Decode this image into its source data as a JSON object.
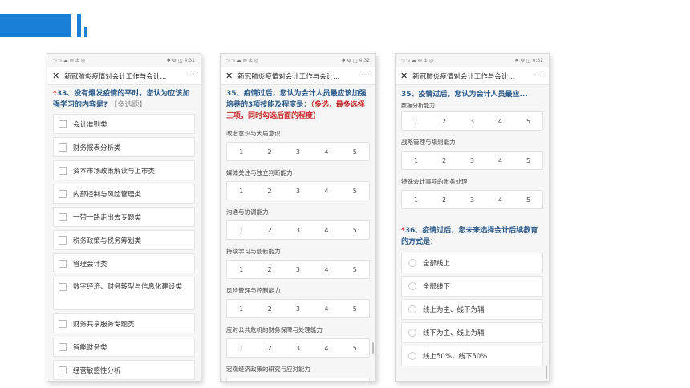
{
  "brand_color": "#1a7fd6",
  "phones": [
    {
      "status_left": "ⁿᵢₗ ⁿᵢₗ ☁ ✉ ⚓ ◎",
      "status_right": "✱ ⚙ ◫ 4:31",
      "nav_title": "新冠肺炎疫情对会计工作与会计...",
      "more": "···",
      "question": {
        "required": "*",
        "text": "33、没有爆发疫情的平时，您认为应该加强学习的内容是?",
        "hint": "【多选题】"
      },
      "options": [
        "会计准则类",
        "财务报表分析类",
        "资本市场政策解读与上市类",
        "内部控制与风险管理类",
        "一带一路走出去专题类",
        "税务政策与税务筹划类",
        "管理会计类",
        "数字经济、财务转型与信息化建设类",
        "财务共享服务专题类",
        "智能财务类",
        "经营敏感性分析"
      ]
    },
    {
      "status_left": "ⁿᵢₗ ⁿᵢₗ ☁ ✉ ⚓ ◎",
      "status_right": "✱ ⚙ ◫ 4:32",
      "nav_title": "新冠肺炎疫情对会计工作与会计...",
      "more": "···",
      "question": {
        "text": "35、疫情过后，您认为会计人员最应该加强培养的3项技能及程度是：",
        "red": "（多选，最多选择三项，同时勾选后面的程度）"
      },
      "scale_values": [
        "1",
        "2",
        "3",
        "4",
        "5"
      ],
      "ratings": [
        "政治意识与大局意识",
        "媒体关注与独立判断能力",
        "沟通与协调能力",
        "持续学习与创新能力",
        "风险管理与控制能力",
        "应对公共危机的财务保障与处理能力",
        "宏观经济政策的研究与应对能力"
      ]
    },
    {
      "status_left": "ⁿᵢₗ ⁿᵢₗ ☁ ✉ ⚓ ◎",
      "status_right": "✱ ⚙ ◫ 4:32",
      "nav_title": "新冠肺炎疫情对会计工作与会计...",
      "more": "···",
      "sticky_header": "35、疫情过后，您认为会计人员最应...",
      "cut_label": "数据分析能力",
      "scale_values": [
        "1",
        "2",
        "3",
        "4",
        "5"
      ],
      "ratings": [
        "战略管理与规划能力",
        "特殊会计事项的账务处理"
      ],
      "question": {
        "required": "*",
        "text": "36、疫情过后，您未来选择会计后续教育的方式是："
      },
      "options": [
        "全部线上",
        "全部线下",
        "线上为主、线下为辅",
        "线下为主、线上为辅",
        "线上50%，线下50%"
      ]
    }
  ]
}
